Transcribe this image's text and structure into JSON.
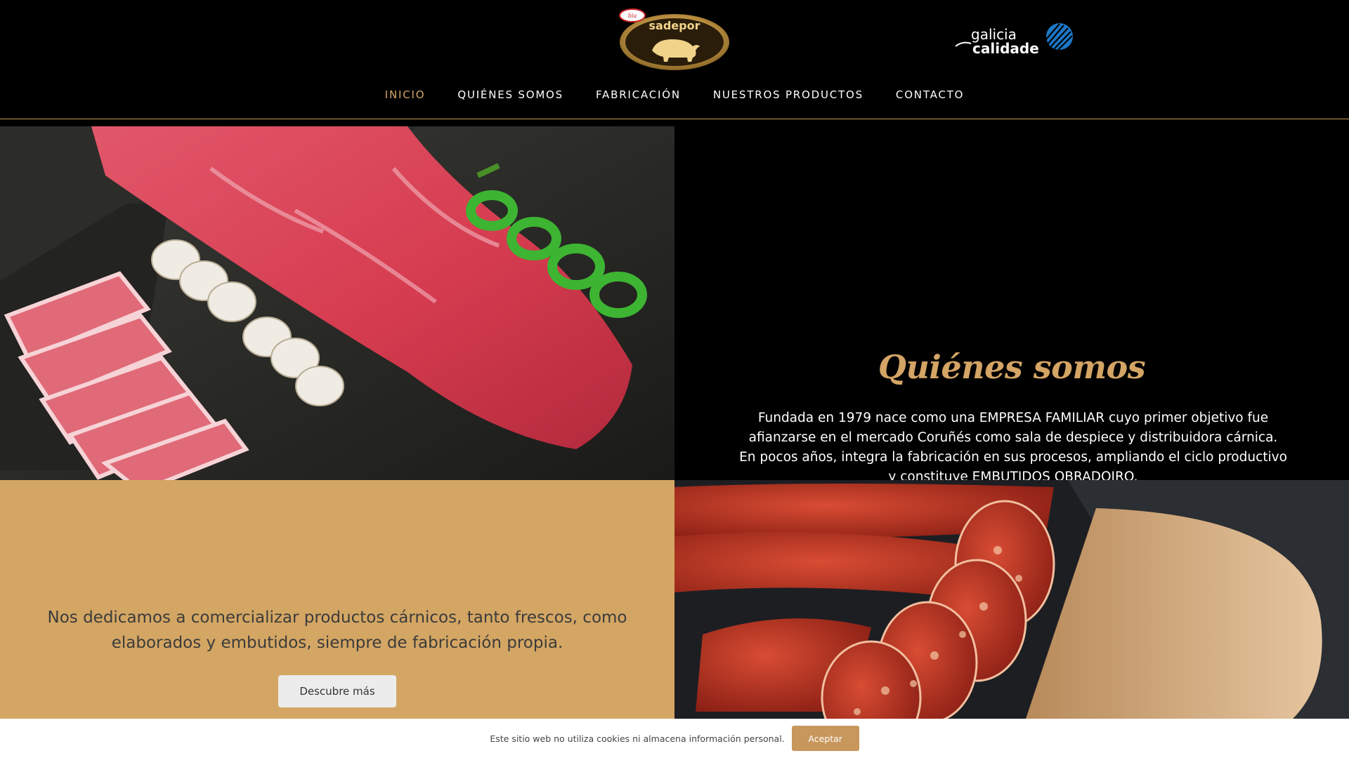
{
  "brand": {
    "logo_text": "sadepor",
    "partner_logo_line1": "galicia",
    "partner_logo_line2": "calidade"
  },
  "nav": {
    "items": [
      {
        "label": "INICIO",
        "active": true
      },
      {
        "label": "QUIÉNES SOMOS",
        "active": false
      },
      {
        "label": "FABRICACIÓN",
        "active": false
      },
      {
        "label": "NUESTROS PRODUCTOS",
        "active": false
      },
      {
        "label": "CONTACTO",
        "active": false
      }
    ]
  },
  "about": {
    "title": "Quiénes somos",
    "text": "Fundada en 1979 nace como una EMPRESA FAMILIAR cuyo primer objetivo fue afianzarse en el mercado Coruñés como sala de despiece y distribuidora cárnica. En pocos años, integra la fabricación en sus procesos, ampliando el ciclo productivo y constituye EMBUTIDOS OBRADOIRO."
  },
  "dedication": {
    "text": "Nos dedicamos a comercializar productos cárnicos, tanto frescos, como elaborados y embutidos, siempre de fabricación propia.",
    "button_label": "Descubre más"
  },
  "cookie_bar": {
    "text": "Este sitio web no utiliza cookies ni almacena información personal.",
    "accept_label": "Aceptar"
  },
  "colors": {
    "accent": "#d4a465",
    "panel": "#d4a664",
    "header_bg": "#000000",
    "accept_button": "#c7975c"
  },
  "images": {
    "row1_left": "pork-loin-mushrooms-peppers-photo",
    "row2_right": "chorizo-on-wood-board-photo"
  }
}
